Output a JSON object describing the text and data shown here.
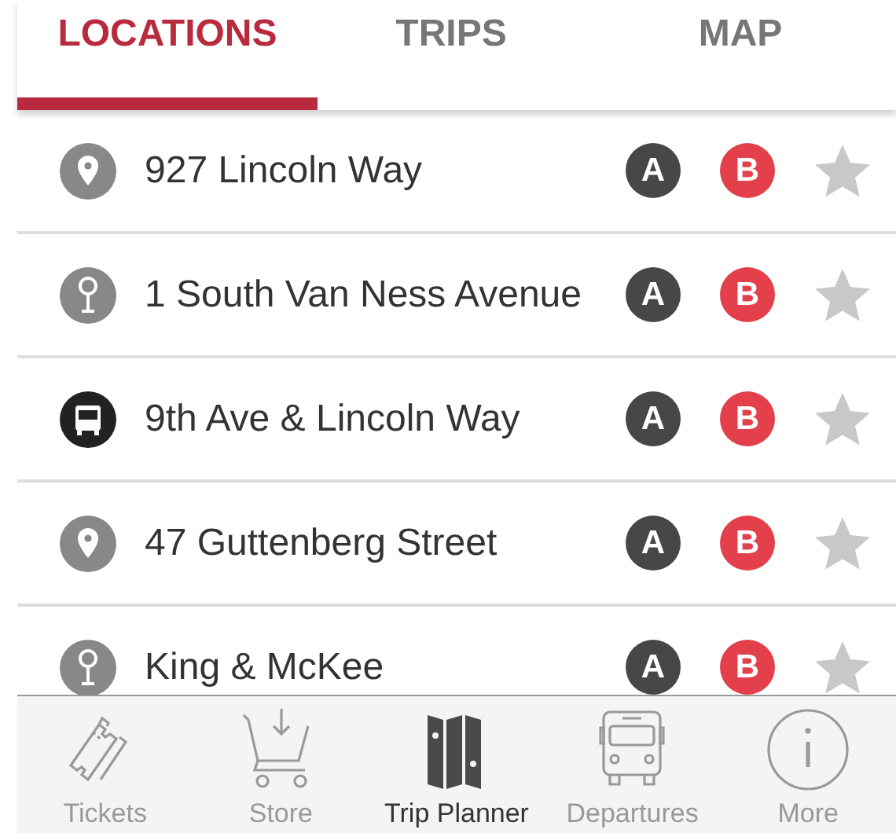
{
  "tabs": [
    {
      "label": "LOCATIONS",
      "selected": true
    },
    {
      "label": "TRIPS",
      "selected": false
    },
    {
      "label": "MAP",
      "selected": false
    }
  ],
  "locations": [
    {
      "kind": "pin",
      "name": "927 Lincoln Way",
      "start": "A",
      "end": "B",
      "favorite": false
    },
    {
      "kind": "stop",
      "name": "1 South Van Ness Avenue",
      "start": "A",
      "end": "B",
      "favorite": false
    },
    {
      "kind": "bus",
      "name": "9th Ave & Lincoln Way",
      "start": "A",
      "end": "B",
      "favorite": false
    },
    {
      "kind": "pin",
      "name": "47 Guttenberg Street",
      "start": "A",
      "end": "B",
      "favorite": false
    },
    {
      "kind": "stop",
      "name": "King & McKee",
      "start": "A",
      "end": "B",
      "favorite": false
    }
  ],
  "bottom_nav": [
    {
      "kind": "tickets",
      "label": "Tickets",
      "selected": false
    },
    {
      "kind": "store",
      "label": "Store",
      "selected": false
    },
    {
      "kind": "planner",
      "label": "Trip Planner",
      "selected": true
    },
    {
      "kind": "departures",
      "label": "Departures",
      "selected": false
    },
    {
      "kind": "more",
      "label": "More",
      "selected": false
    }
  ]
}
